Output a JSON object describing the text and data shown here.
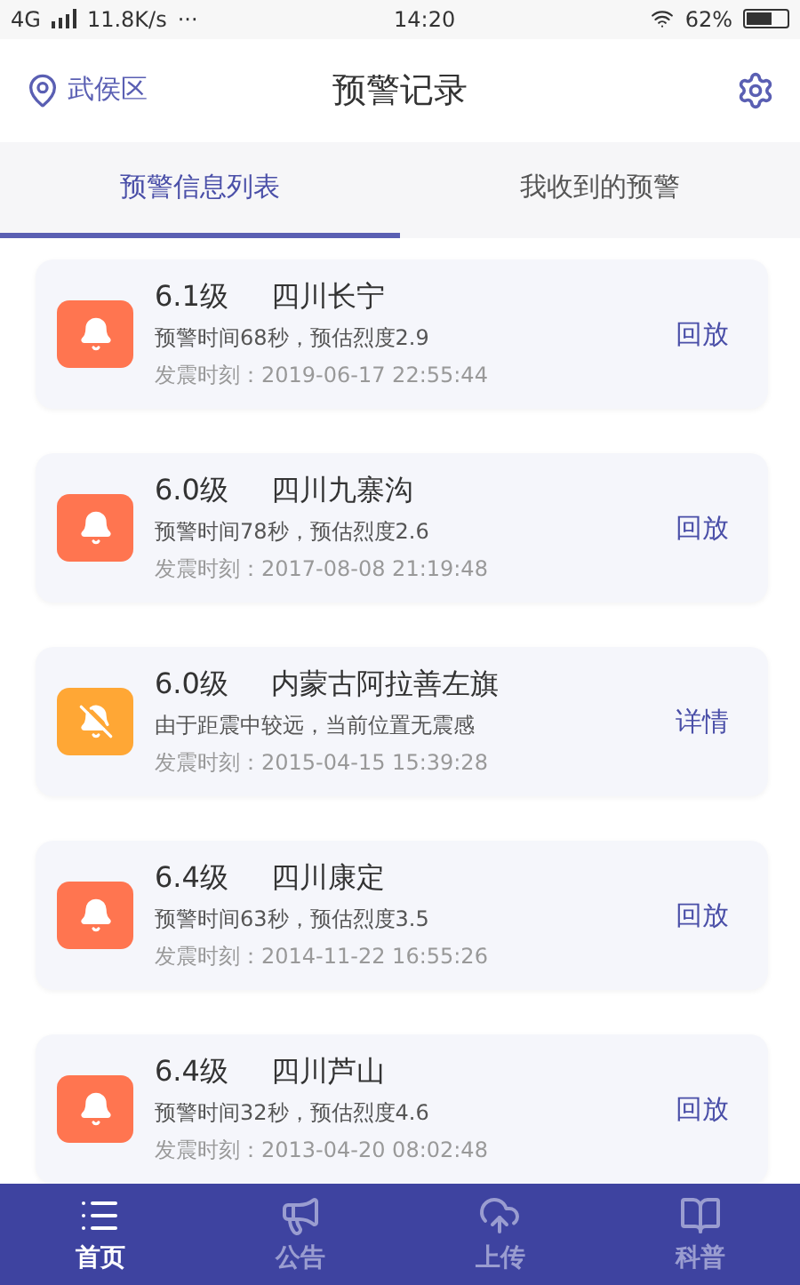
{
  "status_bar": {
    "network": "4G",
    "speed": "11.8K/s",
    "more": "···",
    "time": "14:20",
    "battery": "62%"
  },
  "header": {
    "location": "武侯区",
    "title": "预警记录"
  },
  "tabs": [
    {
      "label": "预警信息列表",
      "selected": true
    },
    {
      "label": "我收到的预警",
      "selected": false
    }
  ],
  "records": [
    {
      "kind": "alert",
      "magnitude": "6.1级",
      "place": "四川长宁",
      "detail": "预警时间68秒，预估烈度2.9",
      "time": "发震时刻：2019-06-17 22:55:44",
      "action": "回放"
    },
    {
      "kind": "alert",
      "magnitude": "6.0级",
      "place": "四川九寨沟",
      "detail": "预警时间78秒，预估烈度2.6",
      "time": "发震时刻：2017-08-08 21:19:48",
      "action": "回放"
    },
    {
      "kind": "muted",
      "magnitude": "6.0级",
      "place": "内蒙古阿拉善左旗",
      "detail": "由于距震中较远，当前位置无震感",
      "time": "发震时刻：2015-04-15 15:39:28",
      "action": "详情"
    },
    {
      "kind": "alert",
      "magnitude": "6.4级",
      "place": "四川康定",
      "detail": "预警时间63秒，预估烈度3.5",
      "time": "发震时刻：2014-11-22 16:55:26",
      "action": "回放"
    },
    {
      "kind": "alert",
      "magnitude": "6.4级",
      "place": "四川芦山",
      "detail": "预警时间32秒，预估烈度4.6",
      "time": "发震时刻：2013-04-20 08:02:48",
      "action": "回放"
    }
  ],
  "nav": [
    {
      "label": "首页",
      "kind": "list",
      "selected": true
    },
    {
      "label": "公告",
      "kind": "megaphone",
      "selected": false
    },
    {
      "label": "上传",
      "kind": "upload",
      "selected": false
    },
    {
      "label": "科普",
      "kind": "book",
      "selected": false
    }
  ]
}
